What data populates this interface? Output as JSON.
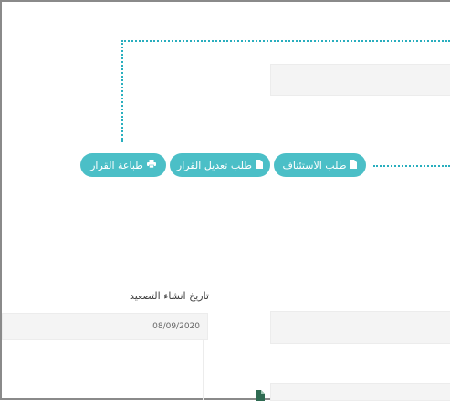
{
  "actions": {
    "appeal_request": {
      "label": "طلب الاستئناف",
      "icon": "file-icon"
    },
    "modify_decision_request": {
      "label": "طلب تعديل القرار",
      "icon": "file-icon"
    },
    "print_decision": {
      "label": "طباعة القرار",
      "icon": "print-icon"
    }
  },
  "form": {
    "escalation_date_label": "تاريخ انشاء التصعيد",
    "escalation_date_value": "08/09/2020"
  },
  "colors": {
    "accent": "#4bbfc7",
    "dotted_connector": "#29aebe"
  }
}
